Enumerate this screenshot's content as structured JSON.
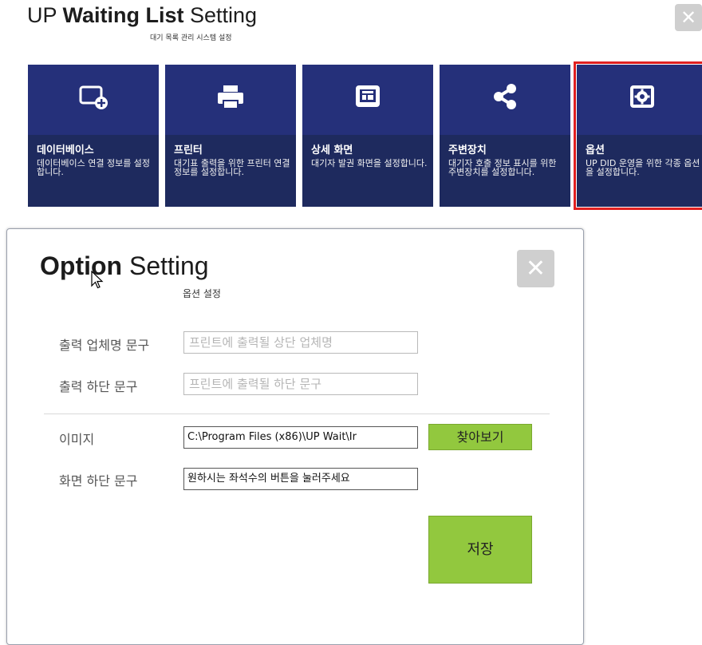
{
  "header": {
    "title_prefix": "UP ",
    "title_bold": "Waiting List",
    "title_suffix": " Setting",
    "subtitle": "대기 목록 관리 시스템 설정"
  },
  "tiles": [
    {
      "name": "데이터베이스",
      "desc": "데이터베이스 연결 정보를 설정합니다.",
      "icon": "database-add-icon"
    },
    {
      "name": "프린터",
      "desc": "대기표 출력을 위한 프린터 연결 정보를 설정합니다.",
      "icon": "printer-icon"
    },
    {
      "name": "상세 화면",
      "desc": "대기자 발권 화면을 설정합니다.",
      "icon": "display-screen-icon"
    },
    {
      "name": "주변장치",
      "desc": "대기자 호출 정보 표시를 위한 주변장치를 설정합니다.",
      "icon": "share-icon"
    },
    {
      "name": "옵션",
      "desc": "UP DID 운영을 위한 각종 옵션을 설정합니다.",
      "icon": "gear-monitor-icon",
      "selected": true
    }
  ],
  "dialog": {
    "title_bold": "Option",
    "title_rest": " Setting",
    "subtitle": "옵션 설정",
    "fields": {
      "company_label": "출력 업체명 문구",
      "company_placeholder": "프린트에 출력될 상단 업체명",
      "footer_label": "출력 하단 문구",
      "footer_placeholder": "프린트에 출력될 하단 문구",
      "image_label": "이미지",
      "image_value": "C:\\Program Files (x86)\\UP Wait\\Ir",
      "browse_label": "찾아보기",
      "screen_footer_label": "화면 하단 문구",
      "screen_footer_value": "원하시는 좌석수의 버튼을 눌러주세요"
    },
    "save_label": "저장"
  },
  "colors": {
    "tile_bg": "#1e2a5e",
    "tile_top": "#25307a",
    "selected_border": "#e02020",
    "green_button": "#92c83e"
  }
}
